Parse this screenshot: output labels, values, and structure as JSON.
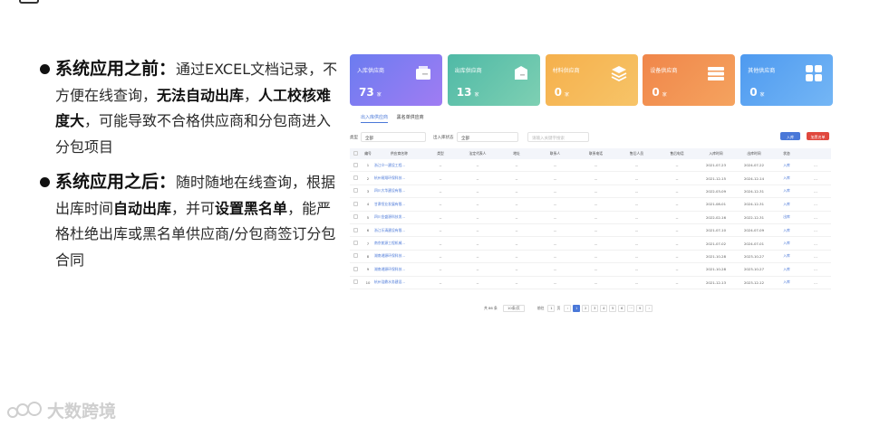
{
  "bullets": [
    {
      "head": "系统应用之前：",
      "parts": [
        {
          "t": "通过EXCEL文档记录，不方便在线查询，",
          "b": false
        },
        {
          "t": "无法自动出库",
          "b": true
        },
        {
          "t": "，",
          "b": false
        },
        {
          "t": "人工校核难度大",
          "b": true
        },
        {
          "t": "，可能导致不合格供应商和分包商进入分包项目",
          "b": false
        }
      ]
    },
    {
      "head": "系统应用之后：",
      "parts": [
        {
          "t": "随时随地在线查询，根据出库时间",
          "b": false
        },
        {
          "t": "自动出库",
          "b": true
        },
        {
          "t": "，并可",
          "b": false
        },
        {
          "t": "设置黑名单",
          "b": true
        },
        {
          "t": "，能严格杜绝出库或黑名单供应商/分包商签订分包合同",
          "b": false
        }
      ]
    }
  ],
  "cards": [
    {
      "title": "入库供应商",
      "value": "73",
      "unit": "家",
      "icon": "inbox-icon",
      "c1": "#6b7cf0",
      "c2": "#a07cf3"
    },
    {
      "title": "出库供应商",
      "value": "13",
      "unit": "家",
      "icon": "outbox-icon",
      "c1": "#4fb9a6",
      "c2": "#7ed0b3"
    },
    {
      "title": "材料供应商",
      "value": "0",
      "unit": "家",
      "icon": "layers-icon",
      "c1": "#f5b04c",
      "c2": "#f7c468"
    },
    {
      "title": "设备供应商",
      "value": "0",
      "unit": "家",
      "icon": "server-icon",
      "c1": "#f0864a",
      "c2": "#f5a35f"
    },
    {
      "title": "其他供应商",
      "value": "0",
      "unit": "家",
      "icon": "grid-icon",
      "c1": "#4e9af0",
      "c2": "#74b6f5"
    }
  ],
  "tabs": [
    "出入库供应商",
    "黑名单供应商"
  ],
  "filters": {
    "type_label": "类型",
    "type_value": "全部",
    "status_label": "出入库状态",
    "status_value": "全部",
    "search_placeholder": "请输入关键字搜索",
    "in_button": "入库",
    "blacklist_button": "加黑名单"
  },
  "columns": [
    "编号",
    "供应商名称",
    "类型",
    "法定代表人",
    "地址",
    "联系人",
    "联系电话",
    "售后人员",
    "售后电话",
    "入库时间",
    "出库时间",
    "状态"
  ],
  "rows": [
    {
      "no": "1",
      "name": "浙江众一建设工程...",
      "in": "2021-07-23",
      "out": "2024-07-22",
      "status": "入库"
    },
    {
      "no": "2",
      "name": "杭州易翔环保科技...",
      "in": "2021-12-15",
      "out": "2024-12-14",
      "status": "入库"
    },
    {
      "no": "3",
      "name": "四川大华建设有限...",
      "in": "2022-03-09",
      "out": "2024-12-31",
      "status": "入库"
    },
    {
      "no": "4",
      "name": "甘肃恒业发展有限...",
      "in": "2021-08-01",
      "out": "2024-12-31",
      "status": "入库"
    },
    {
      "no": "5",
      "name": "四川金盛源科技发...",
      "in": "2022-02-16",
      "out": "2022-12-31",
      "status": "出库"
    },
    {
      "no": "6",
      "name": "浙江乐清建设有限...",
      "in": "2021-07-10",
      "out": "2024-07-09",
      "status": "入库"
    },
    {
      "no": "7",
      "name": "南京航源工程机械...",
      "in": "2021-07-02",
      "out": "2024-07-01",
      "status": "入库"
    },
    {
      "no": "8",
      "name": "湖南湘源环保科技...",
      "in": "2021-10-28",
      "out": "2023-10-27",
      "status": "入库"
    },
    {
      "no": "9",
      "name": "湖南湘源环保科技...",
      "in": "2021-10-28",
      "out": "2023-10-27",
      "status": "入库"
    },
    {
      "no": "10",
      "name": "杭州浩鼎水务建设...",
      "in": "2021-12-13",
      "out": "2023-12-12",
      "status": "入库"
    }
  ],
  "empty_cell": "--",
  "more_cell": "...",
  "pager": {
    "total": "共 86 条",
    "per_page": "10条/页",
    "goto": "前往",
    "goto_value": "1",
    "page_unit": "页",
    "prev": "‹",
    "pages": [
      "1",
      "2",
      "3",
      "4",
      "5",
      "6",
      "···",
      "9"
    ],
    "next": "›"
  },
  "watermark": "大数跨境"
}
